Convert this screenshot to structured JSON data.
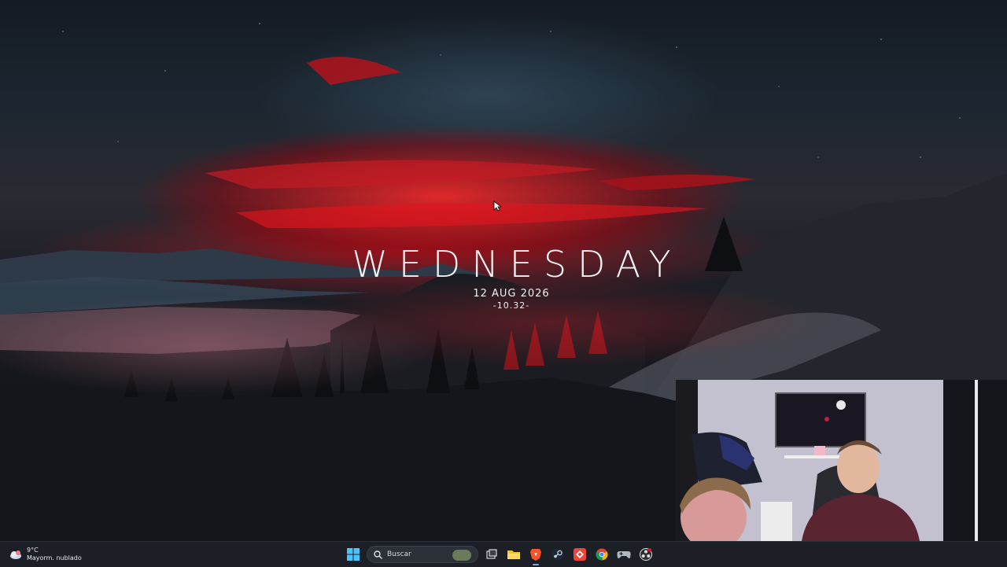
{
  "widget": {
    "day": "WEDNESDAY",
    "date": "12 AUG 2026",
    "time": "-10.32-"
  },
  "taskbar": {
    "weather": {
      "temp": "9°C",
      "condition": "Mayorm. nublado",
      "icon": "weather-cloud-icon"
    },
    "search_placeholder": "Buscar",
    "apps": [
      {
        "name": "start-button",
        "icon": "windows-logo-icon"
      },
      {
        "name": "task-view-button",
        "icon": "task-view-icon"
      },
      {
        "name": "file-explorer-button",
        "icon": "folder-icon"
      },
      {
        "name": "brave-button",
        "icon": "brave-lion-icon",
        "active": true
      },
      {
        "name": "steam-button",
        "icon": "steam-icon"
      },
      {
        "name": "anydesk-button",
        "icon": "anydesk-icon"
      },
      {
        "name": "chrome-button",
        "icon": "chrome-icon"
      },
      {
        "name": "controller-button",
        "icon": "gamepad-icon"
      },
      {
        "name": "obs-button",
        "icon": "obs-icon"
      }
    ]
  },
  "colors": {
    "taskbar": "#1c1f26",
    "accent_red": "#e0161e",
    "widget_text": "#f2f2f2"
  }
}
